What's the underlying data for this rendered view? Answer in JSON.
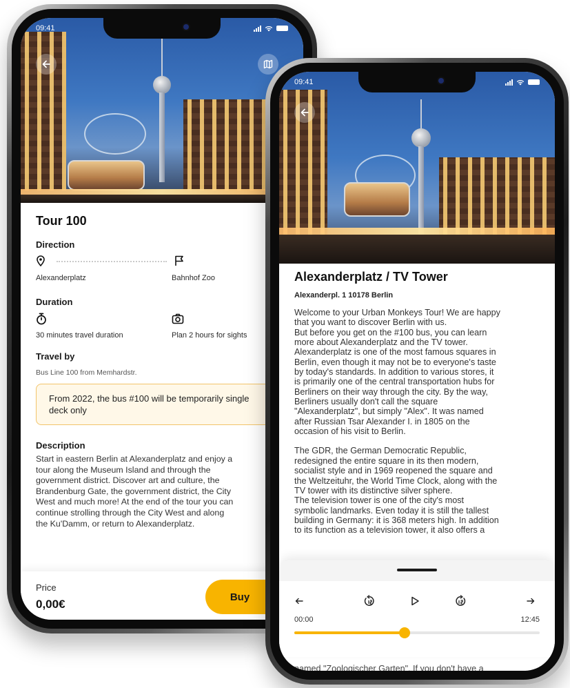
{
  "phone1": {
    "status": {
      "time": "09:41"
    },
    "title": "Tour 100",
    "direction": {
      "label": "Direction",
      "from": "Alexanderplatz",
      "to": "Bahnhof Zoo"
    },
    "duration": {
      "label": "Duration",
      "travel": "30 minutes travel duration",
      "sights": "Plan 2 hours for sights"
    },
    "travel_by": {
      "label": "Travel by",
      "value": "Bus Line 100 from Memhardstr."
    },
    "notice": "From 2022, the bus #100 will be temporarily single deck only",
    "description": {
      "label": "Description",
      "lines": [
        "Start in eastern Berlin at Alexanderplatz and enjoy a",
        "tour along the Museum Island and through the",
        "government district. Discover art and culture, the",
        "Brandenburg Gate, the government district, the City",
        "West and much more! At the end of the tour you can",
        "continue strolling through the City West and along",
        "the Ku'Damm, or return to Alexanderplatz."
      ]
    },
    "footer": {
      "price_label": "Price",
      "price_value": "0,00€",
      "buy_label": "Buy"
    },
    "icons": {
      "back": "back-arrow-icon",
      "map": "map-icon"
    }
  },
  "phone2": {
    "status": {
      "time": "09:41"
    },
    "title": "Alexanderplatz / TV Tower",
    "address": "Alexanderpl. 1 10178 Berlin",
    "paragraph1": [
      "Welcome to your Urban Monkeys Tour! We are happy",
      "that you want to discover Berlin with us.",
      "But before you get on the #100 bus, you can learn",
      "more about Alexanderplatz and the TV tower.",
      "Alexanderplatz is one of the most famous squares in",
      "Berlin, even though it may not be to everyone's taste",
      "by today's standards. In addition to various stores, it",
      "is primarily one of the central transportation hubs for",
      "Berliners on their way through the city. By the way,",
      "Berliners usually don't call the square",
      "\"Alexanderplatz\", but simply \"Alex\". It was named",
      "after Russian Tsar Alexander I. in 1805 on the",
      "occasion of his visit to Berlin."
    ],
    "paragraph2": [
      "The GDR, the German Democratic Republic,",
      "redesigned the entire square in its then modern,",
      "socialist style and in 1969 reopened the square and",
      "the Weltzeituhr, the World Time Clock, along with the",
      "TV tower with its distinctive silver sphere.",
      "The television tower is one of the city's most",
      "symbolic landmarks. Even today it is still the tallest",
      "building in Germany: it is 368 meters high. In addition",
      "to its function as a television tower, it also offers a"
    ],
    "player": {
      "elapsed": "00:00",
      "total": "12:45",
      "progress": 0.45
    },
    "cut_text": "named \"Zoologischer Garten\". If you don't have a"
  },
  "colors": {
    "accent": "#f8b400",
    "notice_border": "#f2c46a",
    "notice_bg": "#fff8e8"
  }
}
